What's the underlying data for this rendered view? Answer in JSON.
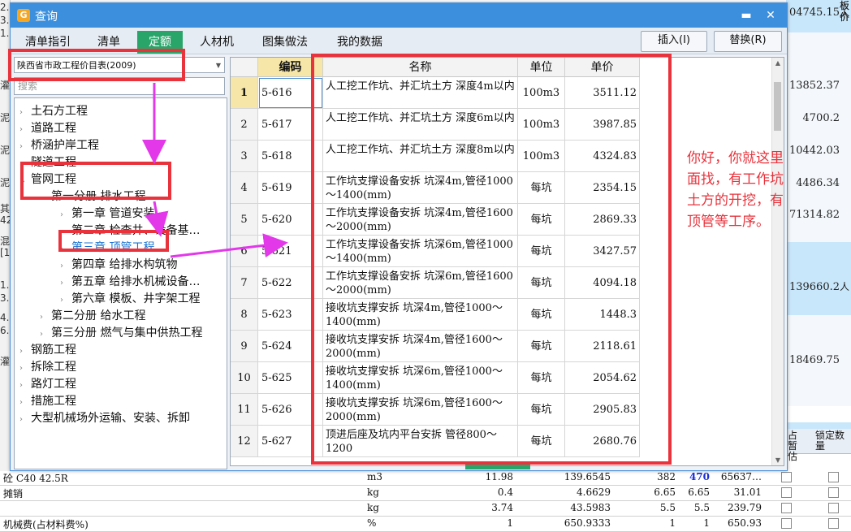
{
  "dialog": {
    "title": "查询",
    "minimize_icon": "minimize-icon",
    "close_icon": "close-icon"
  },
  "tabs": [
    "清单指引",
    "清单",
    "定额",
    "人材机",
    "图集做法",
    "我的数据"
  ],
  "active_tab": "定额",
  "buttons": {
    "insert": "插入(I)",
    "replace": "替换(R)"
  },
  "library": {
    "selected": "陕西省市政工程价目表(2009)"
  },
  "search": {
    "placeholder": "搜索"
  },
  "tree": [
    {
      "label": "土石方工程",
      "expanded": false
    },
    {
      "label": "道路工程",
      "expanded": false
    },
    {
      "label": "桥涵护岸工程",
      "expanded": false
    },
    {
      "label": "隧道工程",
      "expanded": false
    },
    {
      "label": "管网工程",
      "expanded": true
    },
    {
      "label": "第一分册 排水工程",
      "expanded": true
    },
    {
      "label": "第一章 管道安装",
      "expanded": false
    },
    {
      "label": "第二章 检查井、设备基…",
      "expanded": false
    },
    {
      "label": "第三章 顶管工程",
      "expanded": false,
      "selected": true
    },
    {
      "label": "第四章 给排水构筑物",
      "expanded": false
    },
    {
      "label": "第五章 给排水机械设备…",
      "expanded": false
    },
    {
      "label": "第六章 模板、井字架工程",
      "expanded": false
    },
    {
      "label": "第二分册 给水工程",
      "expanded": false
    },
    {
      "label": "第三分册 燃气与集中供热工程",
      "expanded": false
    },
    {
      "label": "钢筋工程",
      "expanded": false
    },
    {
      "label": "拆除工程",
      "expanded": false
    },
    {
      "label": "路灯工程",
      "expanded": false
    },
    {
      "label": "措施工程",
      "expanded": false
    },
    {
      "label": "大型机械场外运输、安装、拆卸",
      "expanded": false
    }
  ],
  "grid": {
    "headers": [
      "编码",
      "名称",
      "单位",
      "单价"
    ],
    "rows": [
      {
        "n": "1",
        "code": "5-616",
        "name": "人工挖工作坑、并汇坑土方 深度4m以内",
        "unit": "100m3",
        "price": "3511.12"
      },
      {
        "n": "2",
        "code": "5-617",
        "name": "人工挖工作坑、并汇坑土方 深度6m以内",
        "unit": "100m3",
        "price": "3987.85"
      },
      {
        "n": "3",
        "code": "5-618",
        "name": "人工挖工作坑、并汇坑土方 深度8m以内",
        "unit": "100m3",
        "price": "4324.83"
      },
      {
        "n": "4",
        "code": "5-619",
        "name": "工作坑支撑设备安拆 坑深4m,管径1000～1400(mm)",
        "unit": "每坑",
        "price": "2354.15"
      },
      {
        "n": "5",
        "code": "5-620",
        "name": "工作坑支撑设备安拆 坑深4m,管径1600～2000(mm)",
        "unit": "每坑",
        "price": "2869.33"
      },
      {
        "n": "6",
        "code": "5-621",
        "name": "工作坑支撑设备安拆 坑深6m,管径1000～1400(mm)",
        "unit": "每坑",
        "price": "3427.57"
      },
      {
        "n": "7",
        "code": "5-622",
        "name": "工作坑支撑设备安拆 坑深6m,管径1600～2000(mm)",
        "unit": "每坑",
        "price": "4094.18"
      },
      {
        "n": "8",
        "code": "5-623",
        "name": "接收坑支撑安拆 坑深4m,管径1000～1400(mm)",
        "unit": "每坑",
        "price": "1448.3"
      },
      {
        "n": "9",
        "code": "5-624",
        "name": "接收坑支撑安拆 坑深4m,管径1600～2000(mm)",
        "unit": "每坑",
        "price": "2118.61"
      },
      {
        "n": "10",
        "code": "5-625",
        "name": "接收坑支撑安拆 坑深6m,管径1000～1400(mm)",
        "unit": "每坑",
        "price": "2054.62"
      },
      {
        "n": "11",
        "code": "5-626",
        "name": "接收坑支撑安拆 坑深6m,管径1600～2000(mm)",
        "unit": "每坑",
        "price": "2905.83"
      },
      {
        "n": "12",
        "code": "5-627",
        "name": "顶进后座及坑内平台安拆 管径800～1200",
        "unit": "每坑",
        "price": "2680.76"
      }
    ]
  },
  "annotation": "你好，你就这里面找，有工作坑土方的开挖，有顶管等工序。",
  "background": {
    "right_amounts": [
      "04745.15",
      "13852.37",
      "4700.2",
      "10442.03",
      "4486.34",
      "71314.82",
      "139660.2",
      "18469.75"
    ],
    "right_side_chars": [
      "人",
      "",
      "板价",
      "",
      "板价",
      "",
      "板价",
      "",
      "人"
    ],
    "left_chars": [
      "2.",
      "3.",
      "1.",
      "灌",
      "泥",
      "泥",
      "泥",
      "其",
      "42",
      "混",
      "[1",
      "1.",
      "3.",
      "4.",
      "6.",
      "灌"
    ],
    "header_labels": [
      "占暂估",
      "锁定数量"
    ],
    "rows": [
      {
        "name": "砼 C40 42.5R",
        "unit": "m3",
        "qty": "11.98",
        "v1": "139.6545",
        "v2": "382",
        "v3": "470",
        "total": "65637…"
      },
      {
        "name": "摊销",
        "unit": "kg",
        "qty": "0.4",
        "v1": "4.6629",
        "v2": "6.65",
        "v3": "6.65",
        "total": "31.01"
      },
      {
        "name": "",
        "unit": "kg",
        "qty": "3.74",
        "v1": "43.5983",
        "v2": "5.5",
        "v3": "5.5",
        "total": "239.79"
      },
      {
        "name": "机械费(占材料费%)",
        "unit": "%",
        "qty": "1",
        "v1": "650.9333",
        "v2": "1",
        "v3": "1",
        "total": "650.93"
      }
    ]
  },
  "colors": {
    "titlebar": "#3c8fdd",
    "active_tab": "#2aa56a",
    "annotation": "#e8333c",
    "arrow": "#e238ea"
  }
}
